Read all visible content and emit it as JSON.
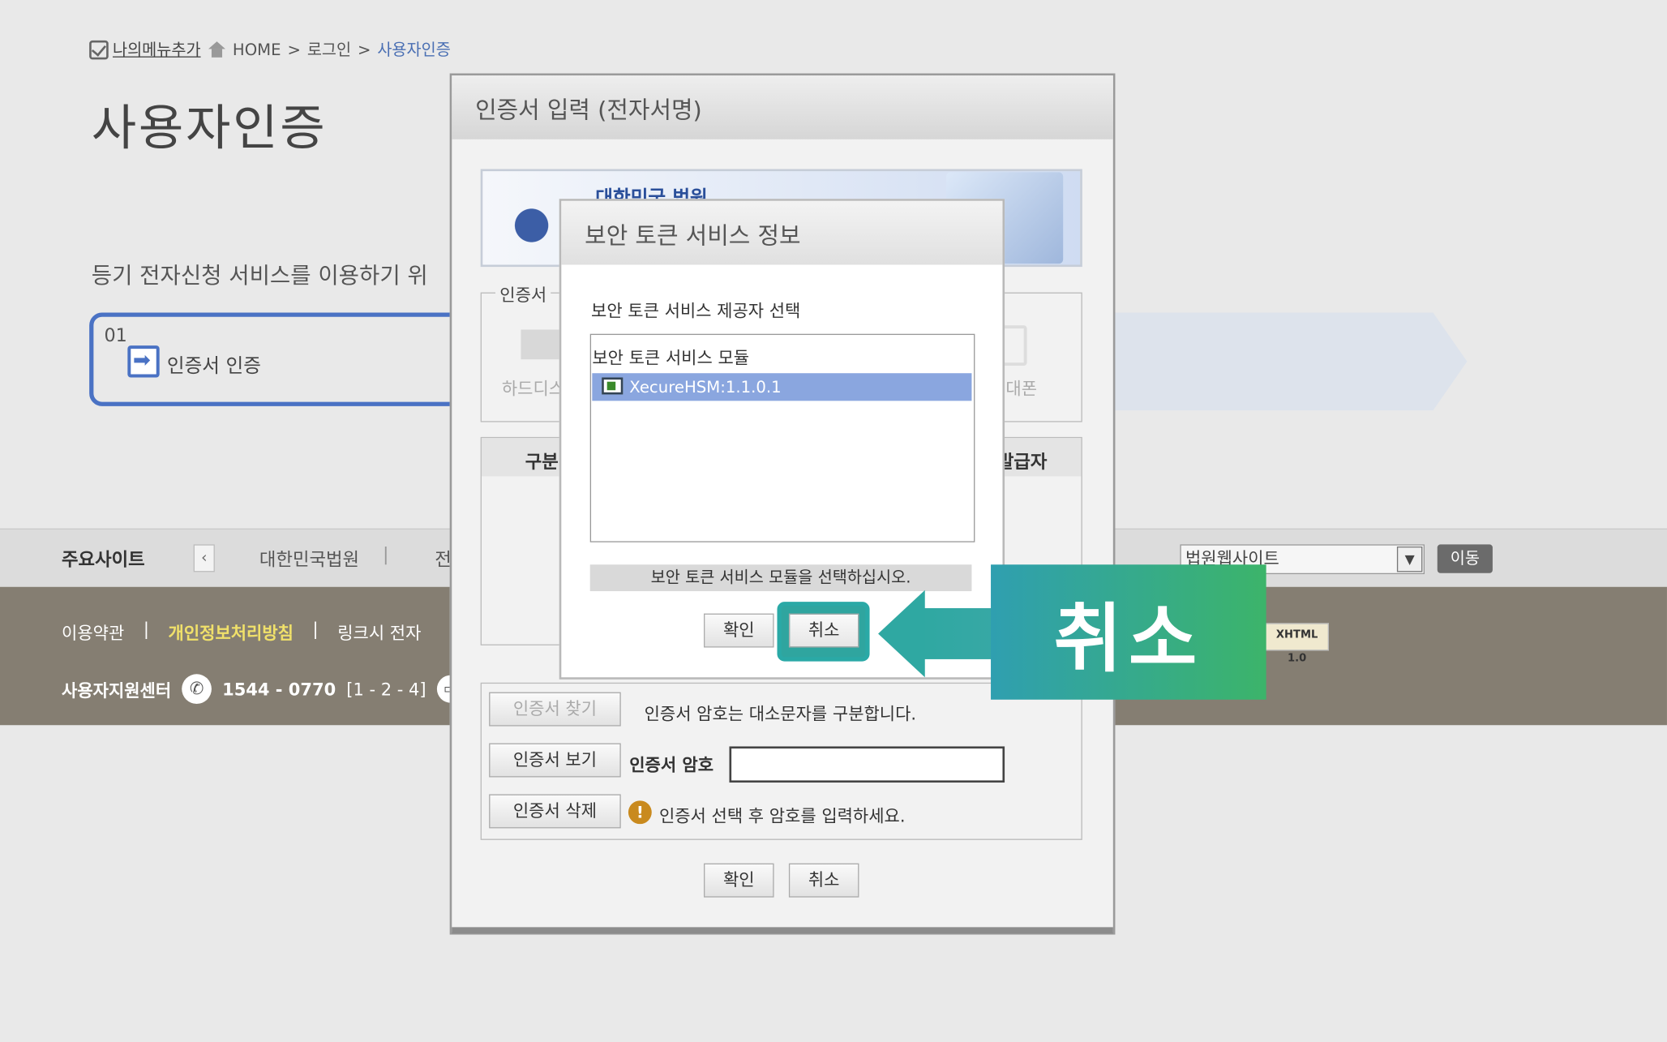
{
  "breadcrumb": {
    "my_menu": "나의메뉴추가",
    "home": "HOME",
    "sep": ">",
    "login": "로그인",
    "current": "사용자인증"
  },
  "page": {
    "title": "사용자인증",
    "intro": "등기 전자신청 서비스를 이용하기 위",
    "step_num": "01",
    "step_label": "인증서 인증"
  },
  "site_bar": {
    "label": "주요사이트",
    "prev": "‹",
    "link1": "대한민국법원",
    "sep": "|",
    "link2": "전",
    "select_value": "법원웹사이트",
    "go": "이동"
  },
  "footer": {
    "terms": "이용약관",
    "sep": "|",
    "privacy": "개인정보처리방침",
    "link3": "링크시 전자",
    "support_label": "사용자지원센터",
    "phone": "1544 - 0770",
    "ext": "[1 - 2 - 4]",
    "xhtml": "XHTML 1.0"
  },
  "cert_dialog": {
    "title": "인증서 입력 (전자서명)",
    "banner_text": "대한민국 법원",
    "location_legend": "인증서",
    "hdd_label": "하드디스",
    "phone_label": "대폰",
    "col_gubun": "구분",
    "col_issuer": "발급자",
    "find_btn": "인증서 찾기",
    "view_btn": "인증서 보기",
    "delete_btn": "인증서 삭제",
    "case_note": "인증서 암호는 대소문자를 구분합니다.",
    "password_label": "인증서 암호",
    "password_value": "",
    "warning": "인증서 선택 후 암호를 입력하세요.",
    "ok": "확인",
    "cancel": "취소"
  },
  "token_dialog": {
    "title": "보안 토큰 서비스 정보",
    "subtitle": "보안 토큰 서비스 제공자 선택",
    "list_header": "보안 토큰 서비스 모듈",
    "items": [
      "XecureHSM:1.1.0.1"
    ],
    "status": "보안 토큰 서비스 모듈을 선택하십시오.",
    "ok": "확인",
    "cancel": "취소"
  },
  "callout": {
    "text": "취소",
    "color": "#2fa59f"
  }
}
